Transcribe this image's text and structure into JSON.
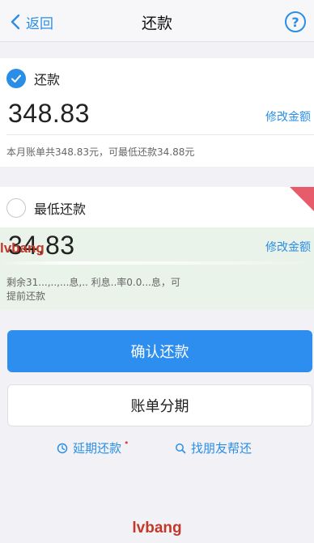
{
  "navbar": {
    "back_label": "返回",
    "title": "还款",
    "help_label": "?"
  },
  "full_repay": {
    "label": "还款",
    "checked": true,
    "amount": "348.83",
    "modify_label": "修改金额",
    "note": "本月账单共348.83元，可最低还款34.88元"
  },
  "min_repay": {
    "label": "最低还款",
    "checked": false,
    "amount": "34.83",
    "modify_label": "修改金额",
    "note_line1": "剩余31...,..,...息,.. 利息..率0.0...息，可",
    "note_line2": "提前还款"
  },
  "buttons": {
    "confirm_label": "确认还款",
    "installment_label": "账单分期"
  },
  "links": {
    "defer_label": "延期还款",
    "friend_label": "找朋友帮还"
  },
  "watermarks": {
    "middle": "lvbang",
    "bottom": "lvbang"
  },
  "colors": {
    "accent": "#2a8ee6",
    "primary_button": "#2d8ef0",
    "watermark": "#c0392b"
  }
}
